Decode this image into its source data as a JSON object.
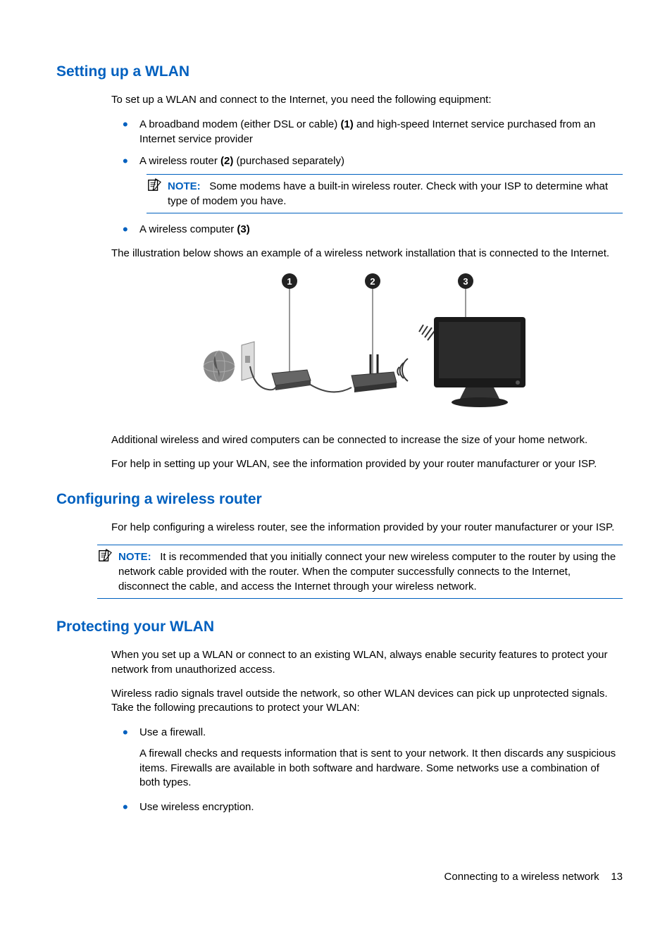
{
  "section1": {
    "heading": "Setting up a WLAN",
    "intro": "To set up a WLAN and connect to the Internet, you need the following equipment:",
    "bullets": [
      {
        "pre": "A broadband modem (either DSL or cable) ",
        "bold": "(1)",
        "post": " and high-speed Internet service purchased from an Internet service provider"
      },
      {
        "pre": "A wireless router ",
        "bold": "(2)",
        "post": " (purchased separately)"
      },
      {
        "pre": "A wireless computer ",
        "bold": "(3)",
        "post": ""
      }
    ],
    "note_label": "NOTE:",
    "note_text": "Some modems have a built-in wireless router. Check with your ISP to determine what type of modem you have.",
    "para_after": "The illustration below shows an example of a wireless network installation that is connected to the Internet.",
    "para_additional": "Additional wireless and wired computers can be connected to increase the size of your home network.",
    "para_help": "For help in setting up your WLAN, see the information provided by your router manufacturer or your ISP."
  },
  "section2": {
    "heading": "Configuring a wireless router",
    "para": "For help configuring a wireless router, see the information provided by your router manufacturer or your ISP.",
    "note_label": "NOTE:",
    "note_text": "It is recommended that you initially connect your new wireless computer to the router by using the network cable provided with the router. When the computer successfully connects to the Internet, disconnect the cable, and access the Internet through your wireless network."
  },
  "section3": {
    "heading": "Protecting your WLAN",
    "para1": "When you set up a WLAN or connect to an existing WLAN, always enable security features to protect your network from unauthorized access.",
    "para2": "Wireless radio signals travel outside the network, so other WLAN devices can pick up unprotected signals. Take the following precautions to protect your WLAN:",
    "bullets": [
      {
        "main": "Use a firewall.",
        "sub": "A firewall checks and requests information that is sent to your network. It then discards any suspicious items. Firewalls are available in both software and hardware. Some networks use a combination of both types."
      },
      {
        "main": "Use wireless encryption.",
        "sub": ""
      }
    ]
  },
  "footer": {
    "title": "Connecting to a wireless network",
    "page": "13"
  }
}
